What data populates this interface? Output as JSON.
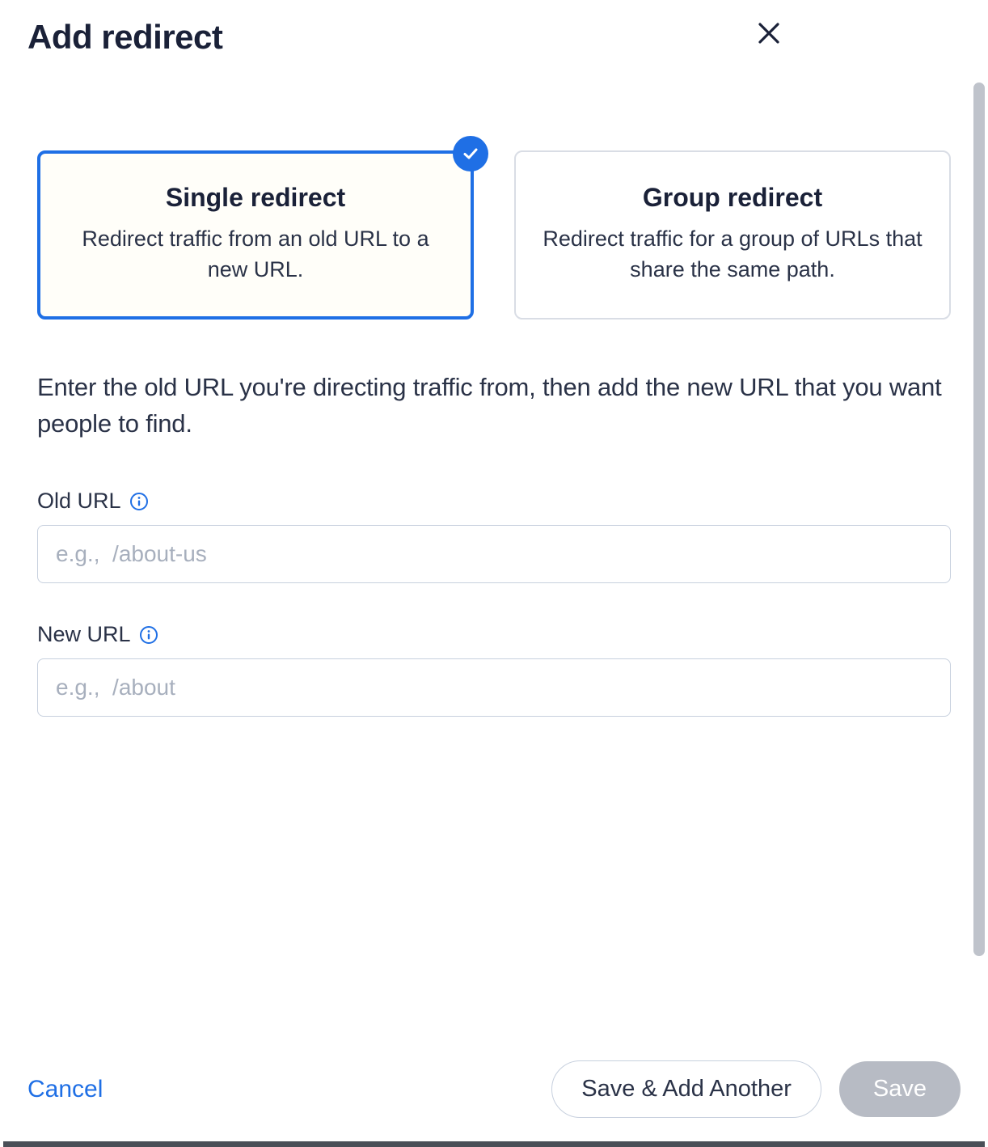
{
  "dialog": {
    "title": "Add redirect"
  },
  "options": {
    "single": {
      "title": "Single redirect",
      "description": "Redirect traffic from an old URL to a new URL.",
      "selected": true
    },
    "group": {
      "title": "Group redirect",
      "description": "Redirect traffic for a group of URLs that share the same path.",
      "selected": false
    }
  },
  "instruction": "Enter the old URL you're directing traffic from, then add the new URL that you want people to find.",
  "fields": {
    "old_url": {
      "label": "Old URL",
      "placeholder": "e.g.,  /about-us",
      "value": ""
    },
    "new_url": {
      "label": "New URL",
      "placeholder": "e.g.,  /about",
      "value": ""
    }
  },
  "footer": {
    "cancel": "Cancel",
    "save_add_another": "Save & Add Another",
    "save": "Save"
  }
}
